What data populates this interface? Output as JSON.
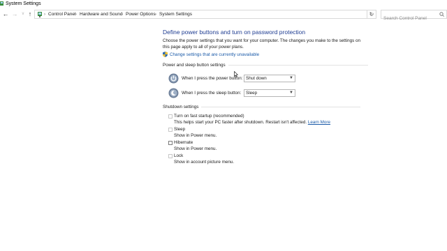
{
  "window": {
    "title": "System Settings"
  },
  "addressbar": {
    "breadcrumbs": [
      "Control Panel",
      "Hardware and Sound",
      "Power Options",
      "System Settings"
    ],
    "search_placeholder": "Search Control Panel"
  },
  "main": {
    "title": "Define power buttons and turn on password protection",
    "description": "Choose the power settings that you want for your computer. The changes you make to the settings on this page apply to all of your power plans.",
    "change_settings_link": "Change settings that are currently unavailable",
    "power_section": {
      "heading": "Power and sleep button settings",
      "rows": [
        {
          "label": "When I press the power button:",
          "value": "Shut down"
        },
        {
          "label": "When I press the sleep button:",
          "value": "Sleep"
        }
      ]
    },
    "shutdown_section": {
      "heading": "Shutdown settings",
      "items": [
        {
          "label": "Turn on fast startup (recommended)",
          "sub": "This helps start your PC faster after shutdown. Restart isn't affected.",
          "link": "Learn More",
          "checked": false,
          "enabled": false
        },
        {
          "label": "Sleep",
          "sub": "Show in Power menu.",
          "checked": false,
          "enabled": false
        },
        {
          "label": "Hibernate",
          "sub": "Show in Power menu.",
          "checked": false,
          "enabled": true
        },
        {
          "label": "Lock",
          "sub": "Show in account picture menu.",
          "checked": false,
          "enabled": false
        }
      ]
    }
  },
  "colors": {
    "title_blue": "#1e3c91",
    "link_blue": "#1a5aa8",
    "divider": "#e2e2e2"
  }
}
